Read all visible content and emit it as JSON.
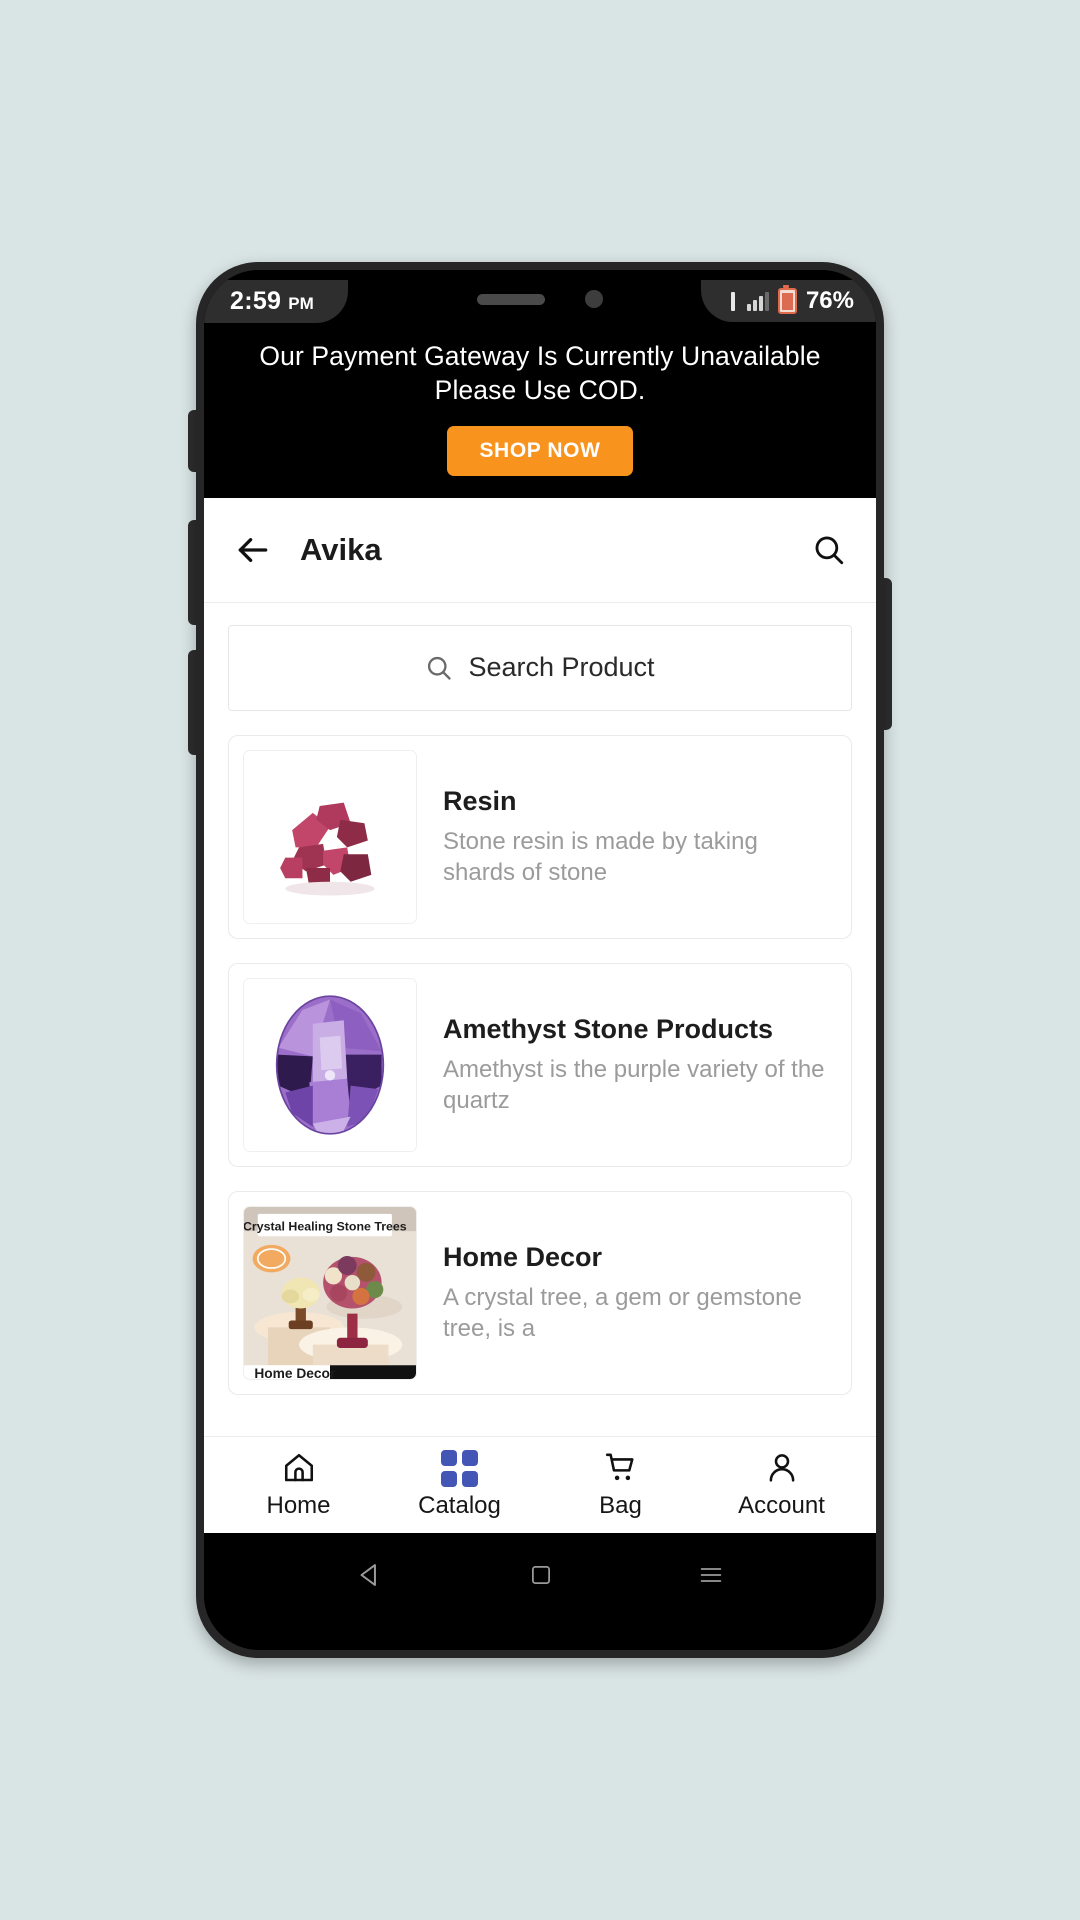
{
  "status_bar": {
    "time": "2:59",
    "ampm": "PM",
    "battery_percent": "76%",
    "signal_icon": "signal-bars-icon",
    "battery_icon": "battery-icon"
  },
  "promo": {
    "line1": "Our Payment Gateway Is Currently Unavailable",
    "line2": "Please Use COD.",
    "button_label": "SHOP NOW",
    "button_color": "#f8931e"
  },
  "appbar": {
    "back_icon": "back-arrow-icon",
    "title": "Avika",
    "search_icon": "search-icon"
  },
  "search": {
    "placeholder": "Search Product",
    "icon": "search-icon"
  },
  "products": [
    {
      "title": "Resin",
      "description": "Stone resin is made by taking shards of stone",
      "image_alt": "resin-stone-chunks"
    },
    {
      "title": "Amethyst Stone Products",
      "description": "Amethyst is the purple variety of the quartz",
      "image_alt": "amethyst-oval-gemstone"
    },
    {
      "title": "Home Decor",
      "description": "A crystal tree, a gem or gemstone tree, is a",
      "image_alt": "crystal-healing-stone-trees",
      "image_caption_top": "Crystal Healing Stone Trees",
      "image_caption_bottom": "Home Decor"
    }
  ],
  "bottom_nav": {
    "active": "Catalog",
    "active_color": "#4355b5",
    "items": [
      {
        "label": "Home",
        "icon": "home-icon"
      },
      {
        "label": "Catalog",
        "icon": "grid-icon"
      },
      {
        "label": "Bag",
        "icon": "shopping-cart-icon"
      },
      {
        "label": "Account",
        "icon": "person-icon"
      }
    ]
  },
  "android_nav": {
    "back": "triangle-back-icon",
    "home": "square-home-icon",
    "recents": "hamburger-recents-icon"
  }
}
